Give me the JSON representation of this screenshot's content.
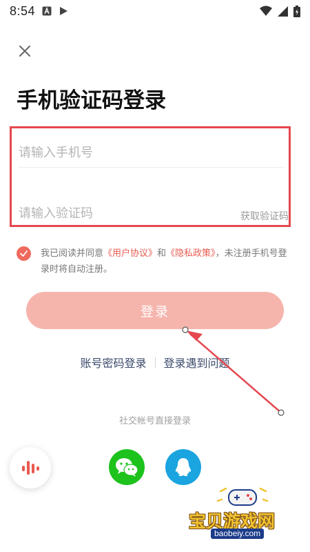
{
  "status_bar": {
    "time": "8:54",
    "left_icons": [
      "a-icon",
      "play-icon"
    ],
    "right_icons": [
      "wifi-icon",
      "signal-icon",
      "battery-icon"
    ]
  },
  "page": {
    "title": "手机验证码登录"
  },
  "form": {
    "phone_placeholder": "请输入手机号",
    "code_placeholder": "请输入验证码",
    "get_code_label": "获取验证码",
    "highlight_color": "#e5474f"
  },
  "agreement": {
    "checked": true,
    "prefix": "我已阅读并同意",
    "user_agreement": "《用户协议》",
    "and": "和",
    "privacy_policy": "《隐私政策》",
    "suffix": "，未注册手机号登录时将自动注册。"
  },
  "login_button": {
    "label": "登录",
    "color": "#f5b5ad"
  },
  "alt_links": {
    "password_login": "账号密码登录",
    "login_problem": "登录遇到问题"
  },
  "social": {
    "title": "社交帐号直接登录",
    "wechat_icon": "wechat-icon",
    "qq_icon": "qq-icon"
  },
  "voice_button": {
    "icon": "voice-wave-icon"
  },
  "watermark": {
    "cn": "宝贝游戏网",
    "url": "baobeiy.com"
  },
  "colors": {
    "accent": "#e75b50",
    "wechat": "#1dc21d",
    "qq": "#1aa4e0"
  }
}
